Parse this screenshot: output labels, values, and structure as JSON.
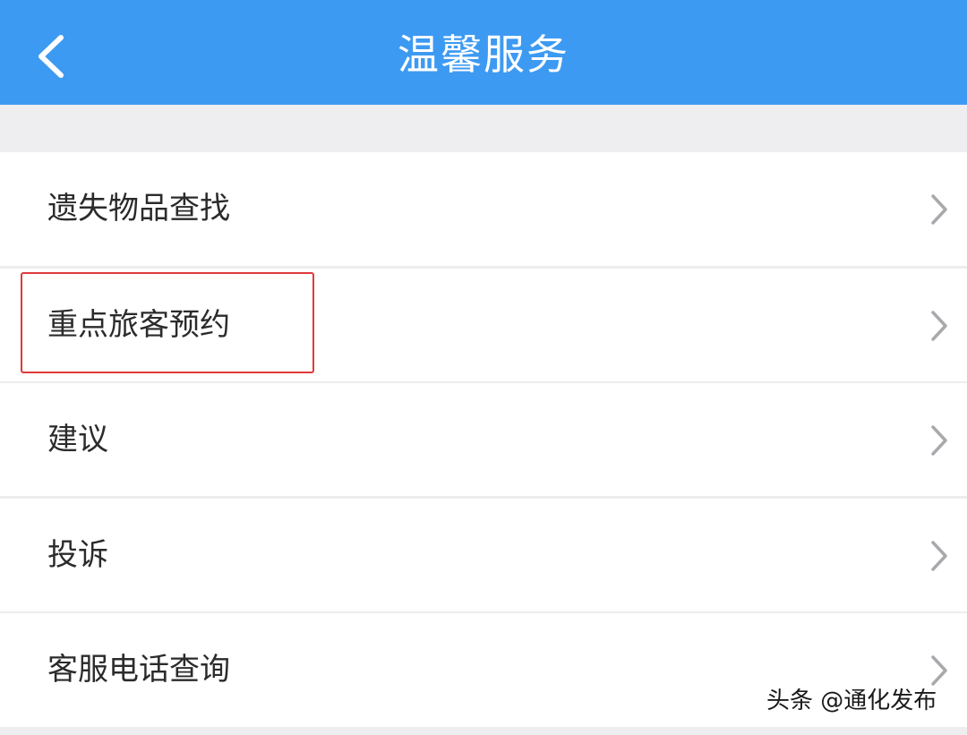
{
  "header": {
    "title": "温馨服务",
    "background_color": "#3d9af2"
  },
  "menu": {
    "items": [
      {
        "label": "遗失物品查找"
      },
      {
        "label": "重点旅客预约"
      },
      {
        "label": "建议"
      },
      {
        "label": "投诉"
      },
      {
        "label": "客服电话查询"
      }
    ]
  },
  "highlight": {
    "color": "#e03a3a"
  },
  "watermark": {
    "text": "头条 @通化发布"
  }
}
